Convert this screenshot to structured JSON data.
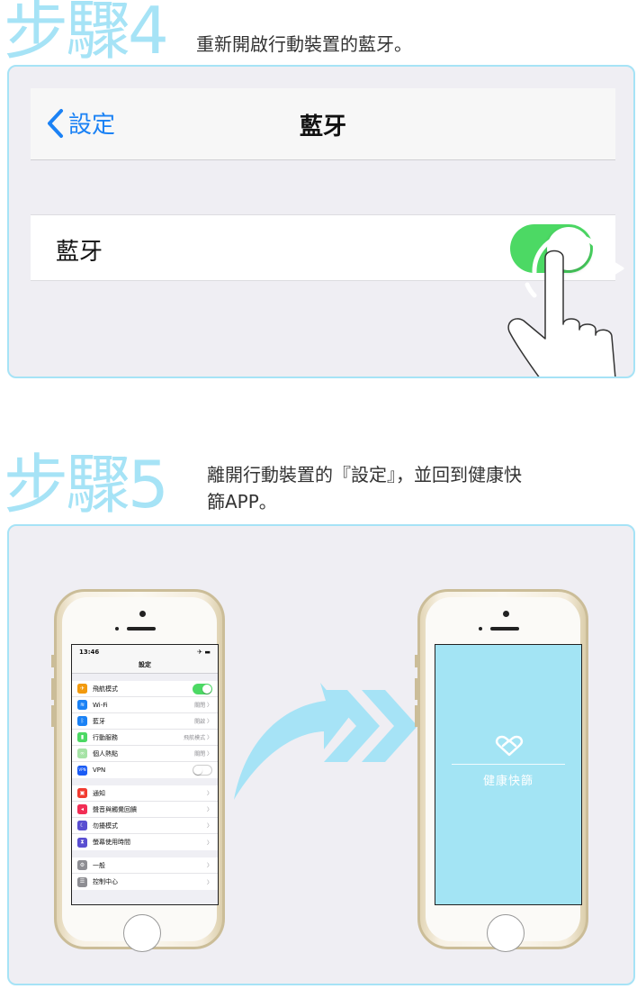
{
  "step4": {
    "title": "步驟4",
    "desc": "重新開啟行動裝置的藍牙。",
    "nav_back": "設定",
    "nav_title": "藍牙",
    "row_label": "藍牙",
    "toggle_state": "on"
  },
  "step5": {
    "title": "步驟5",
    "desc_line1": "離開行動裝置的『設定』，並回到健康快",
    "desc_line2": "篩APP。",
    "settings_screen": {
      "time": "13:46",
      "status_icons": "✈ ▬",
      "title": "設定",
      "group1": [
        {
          "label": "飛航模式",
          "value": "",
          "toggle": "on",
          "icon_color": "#f29a0e",
          "icon": "✈"
        },
        {
          "label": "Wi-Fi",
          "value": "關閉 〉",
          "icon_color": "#1b82f5",
          "icon": "≋"
        },
        {
          "label": "藍牙",
          "value": "開啟 〉",
          "icon_color": "#1b82f5",
          "icon": "ᛒ"
        },
        {
          "label": "行動服務",
          "value": "飛航模式 〉",
          "icon_color": "#4cd964",
          "icon": "▮"
        },
        {
          "label": "個人熱點",
          "value": "關閉 〉",
          "icon_color": "#a6e3a6",
          "icon": "∞"
        },
        {
          "label": "VPN",
          "value": "",
          "toggle": "off",
          "icon_color": "#1b5cf5",
          "icon": "VPN"
        }
      ],
      "group2": [
        {
          "label": "通知",
          "value": "〉",
          "icon_color": "#f23b30",
          "icon": "▣"
        },
        {
          "label": "聲音與觸覺回饋",
          "value": "〉",
          "icon_color": "#f22e55",
          "icon": "◂"
        },
        {
          "label": "勿擾模式",
          "value": "〉",
          "icon_color": "#5a4fd1",
          "icon": "☾"
        },
        {
          "label": "螢幕使用時間",
          "value": "〉",
          "icon_color": "#5a4fd1",
          "icon": "⧗"
        }
      ],
      "group3": [
        {
          "label": "一般",
          "value": "〉",
          "icon_color": "#8e8e93",
          "icon": "⚙"
        },
        {
          "label": "控制中心",
          "value": "〉",
          "icon_color": "#8e8e93",
          "icon": "☰"
        }
      ]
    },
    "app_screen": {
      "app_name": "健康快篩"
    }
  },
  "colors": {
    "accent": "#a6e3f6",
    "ios_blue": "#1b82f5",
    "toggle_green": "#4cd964",
    "app_bg": "#a3e4f4"
  }
}
